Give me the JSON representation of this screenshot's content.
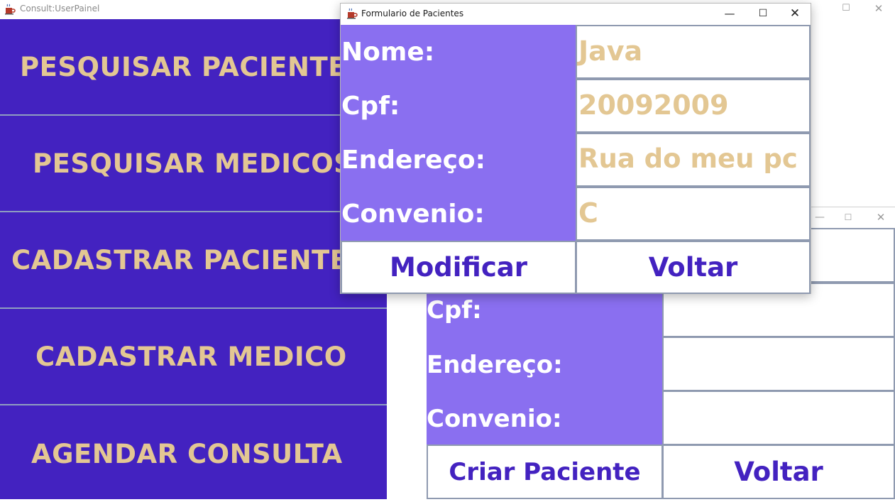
{
  "main_window": {
    "title": "Consult:UserPainel",
    "menu": [
      "PESQUISAR PACIENTES",
      "PESQUISAR MEDICOS",
      "CADASTRAR PACIENTE",
      "CADASTRAR MEDICO",
      "AGENDAR CONSULTA"
    ]
  },
  "back_form": {
    "labels": [
      "Cpf:",
      "Endereço:",
      "Convenio:"
    ],
    "values": [
      "",
      "",
      ""
    ],
    "create_button": "Criar Paciente",
    "back_button": "Voltar"
  },
  "dialog": {
    "title": "Formulario de Pacientes",
    "labels": [
      "Nome:",
      "Cpf:",
      "Endereço:",
      "Convenio:"
    ],
    "values": [
      "Java",
      "20092009",
      "Rua do meu pc",
      "C"
    ],
    "modify_button": "Modificar",
    "back_button": "Voltar"
  },
  "colors": {
    "menu_bg": "#4322c0",
    "menu_text": "#e3c793",
    "label_col_bg": "#8a6ff0",
    "button_text": "#4322c0",
    "field_text": "#e3c793"
  },
  "icons": {
    "app_icon": "java-cup-icon",
    "minimize": "minimize-icon",
    "maximize": "maximize-icon",
    "close": "close-icon"
  }
}
